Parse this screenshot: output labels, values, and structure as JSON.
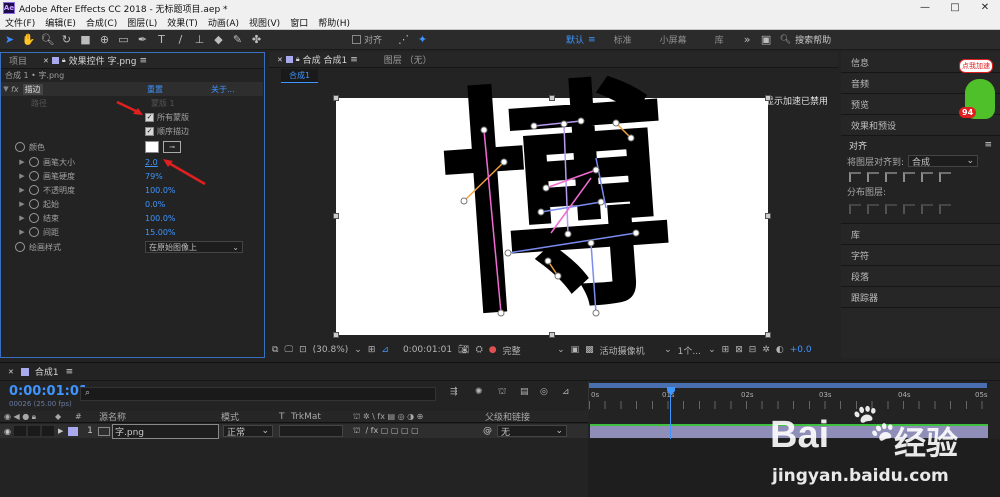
{
  "window": {
    "title": "Adobe After Effects CC 2018 - 无标题项目.aep *",
    "logo": "Ae",
    "minimize": "—",
    "maximize": "□",
    "close": "✕"
  },
  "menu": [
    "文件(F)",
    "编辑(E)",
    "合成(C)",
    "图层(L)",
    "效果(T)",
    "动画(A)",
    "视图(V)",
    "窗口",
    "帮助(H)"
  ],
  "toolbar": {
    "align_label": "对齐",
    "workspaces": [
      "默认",
      "标准",
      "小屏幕",
      "库"
    ],
    "search_placeholder": "搜索帮助"
  },
  "left_panel": {
    "tabs": [
      "项目",
      "效果控件 字.png"
    ],
    "breadcrumb": "合成 1 • 字.png",
    "effect_name": "描边",
    "reset_label": "重置",
    "about_label": "关于...",
    "path_label": "路径",
    "path_value": "蒙版 1",
    "all_masks": "所有蒙版",
    "sequential": "顺序描边",
    "params": [
      {
        "label": "颜色",
        "value": ""
      },
      {
        "label": "画笔大小",
        "value": "2.0"
      },
      {
        "label": "画笔硬度",
        "value": "79%"
      },
      {
        "label": "不透明度",
        "value": "100.0%"
      },
      {
        "label": "起始",
        "value": "0.0%"
      },
      {
        "label": "结束",
        "value": "100.0%"
      },
      {
        "label": "间距",
        "value": "15.00%"
      }
    ],
    "paint_style_label": "绘画样式",
    "paint_style_value": "在原始图像上"
  },
  "comp_panel": {
    "tab": "合成 合成1",
    "layer_tab": "图层 （无）",
    "flow_tab": "合成1",
    "accel_text": "显示加速已禁用",
    "glyph": "博",
    "zoom": "(30.8%)",
    "timecode": "0:00:01:01",
    "quality": "完整",
    "camera": "活动摄像机",
    "views": "1个...",
    "exposure": "+0.0"
  },
  "right_panel": {
    "items": [
      "信息",
      "音频",
      "预览",
      "效果和预设"
    ],
    "align_title": "对齐",
    "align_to_label": "将图层对齐到:",
    "align_to_value": "合成",
    "distribute_label": "分布图层:",
    "items2": [
      "库",
      "字符",
      "段落",
      "跟踪器"
    ],
    "ad_label": "点我加速",
    "ad_value": "94"
  },
  "timeline": {
    "tab": "合成1",
    "timecode": "0:00:01:01",
    "frames": "00026 (25.00 fps)",
    "columns": {
      "source": "源名称",
      "mode": "模式",
      "t": "T",
      "trkmat": "TrkMat",
      "parent": "父级和链接"
    },
    "layer": {
      "num": "1",
      "name": "字.png",
      "mode": "正常",
      "parent": "无"
    },
    "ruler": [
      "0s",
      "01s",
      "02s",
      "03s",
      "04s",
      "05s"
    ]
  },
  "watermark": {
    "brand": "Bai",
    "brand2": "经验",
    "url": "jingyan.baidu.com"
  },
  "colors": {
    "accent": "#3e95ff",
    "bg": "#232323",
    "stroke_orange": "#f0a040",
    "stroke_pink": "#f06ad0",
    "stroke_blue": "#7a8cf0"
  }
}
